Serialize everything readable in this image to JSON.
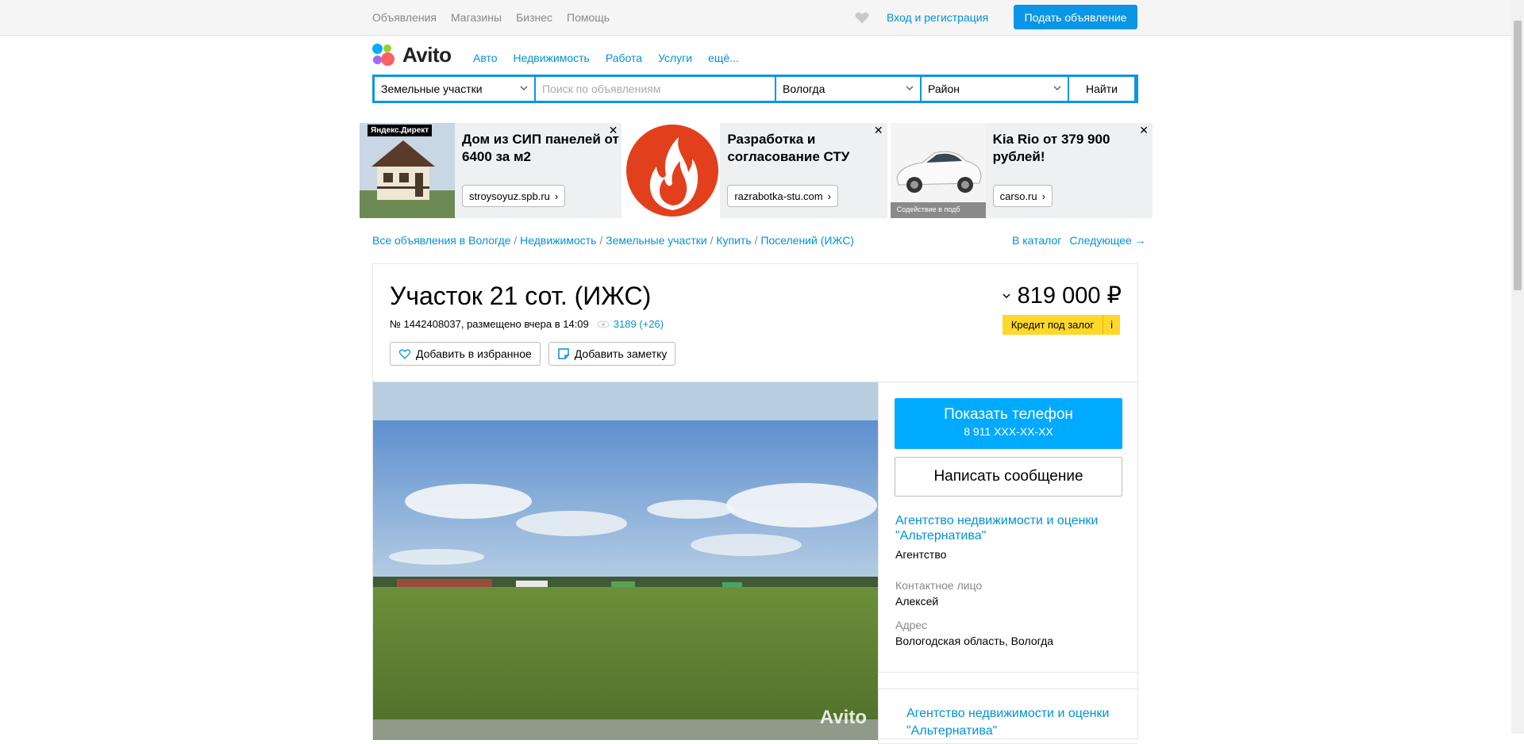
{
  "topbar": {
    "nav": [
      "Объявления",
      "Магазины",
      "Бизнес",
      "Помощь"
    ],
    "login": "Вход и регистрация",
    "post_ad": "Подать объявление"
  },
  "header": {
    "logo_text": "Avito",
    "categories": [
      "Авто",
      "Недвижимость",
      "Работа",
      "Услуги",
      "ещё..."
    ]
  },
  "search": {
    "category": "Земельные участки",
    "placeholder": "Поиск по объявлениям",
    "city": "Вологда",
    "district": "Район",
    "submit": "Найти"
  },
  "ads": [
    {
      "badge": "Яндекс.Директ",
      "title": "Дом из СИП панелей от 6400 за м2",
      "url": "stroysoyuz.spb.ru"
    },
    {
      "title": "Разработка и согласование СТУ",
      "url": "razrabotka-stu.com"
    },
    {
      "title": "Kia Rio от 379 900 рублей!",
      "url": "carso.ru",
      "caption": "Содействие в подб"
    }
  ],
  "breadcrumbs": {
    "path": [
      "Все объявления в Вологде",
      "Недвижимость",
      "Земельные участки",
      "Купить",
      "Поселений (ИЖС)"
    ],
    "catalog": "В каталог",
    "next": "Следующее →"
  },
  "listing": {
    "title": "Участок 21 сот. (ИЖС)",
    "meta": "№ 1442408037, размещено вчера в 14:09",
    "views": "3189 (+26)",
    "add_favorite": "Добавить в избранное",
    "add_note": "Добавить заметку",
    "price": "819 000 ₽",
    "credit": "Кредит под залог",
    "credit_info": "i",
    "photo_watermark": "Avito"
  },
  "contact": {
    "show_phone": "Показать телефон",
    "phone_masked": "8 911 XXX-XX-XX",
    "write_message": "Написать сообщение",
    "seller_name": "Агентство недвижимости и оценки \"Альтернатива\"",
    "seller_type": "Агентство",
    "contact_label": "Контактное лицо",
    "contact_name": "Алексей",
    "address_label": "Адрес",
    "address": "Вологодская область, Вологда"
  },
  "seller_card": {
    "name": "Агентство недвижимости и оценки \"Альтернатива\""
  },
  "colors": {
    "accent": "#0a95e6",
    "link": "#0091d9",
    "phone_button": "#00aaff",
    "credit_badge": "#ffd82a"
  }
}
